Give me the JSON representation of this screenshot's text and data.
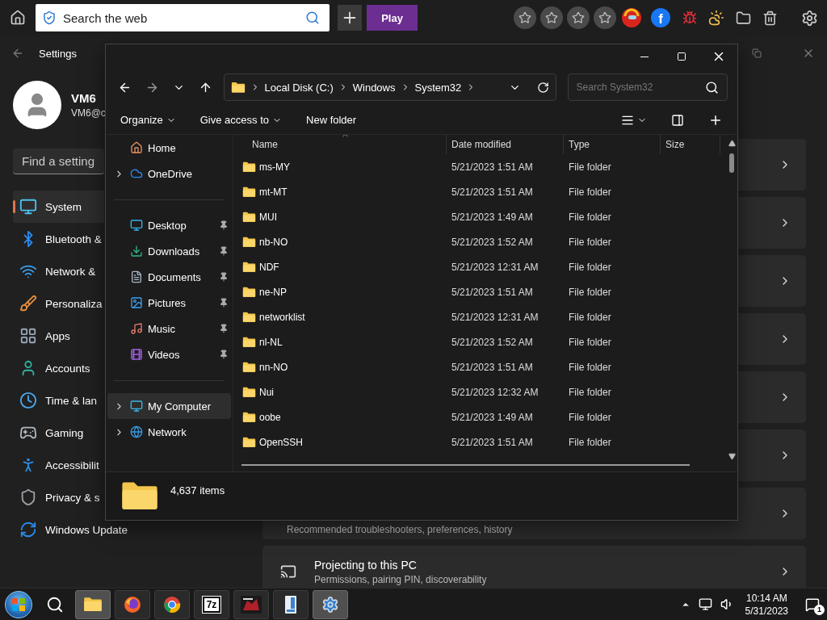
{
  "browser_toolbar": {
    "search": {
      "placeholder": "Search the web"
    },
    "play_button": "Play",
    "shortcuts": [
      {
        "kind": "star"
      },
      {
        "kind": "star"
      },
      {
        "kind": "star"
      },
      {
        "kind": "star"
      },
      {
        "kind": "avatar"
      },
      {
        "kind": "social",
        "label": "f"
      },
      {
        "kind": "bug"
      },
      {
        "kind": "weather"
      },
      {
        "kind": "folder"
      },
      {
        "kind": "trash"
      }
    ]
  },
  "settings": {
    "title": "Settings",
    "user": {
      "name": "VM6",
      "email": "VM6@c"
    },
    "search": {
      "placeholder": "Find a setting"
    },
    "nav": [
      {
        "kind": "system",
        "label": "System",
        "selected": true
      },
      {
        "kind": "bluetooth",
        "label": "Bluetooth &",
        "selected": false
      },
      {
        "kind": "network",
        "label": "Network &",
        "selected": false
      },
      {
        "kind": "personalization",
        "label": "Personaliza",
        "selected": false
      },
      {
        "kind": "apps",
        "label": "Apps",
        "selected": false
      },
      {
        "kind": "accounts",
        "label": "Accounts",
        "selected": false
      },
      {
        "kind": "time",
        "label": "Time & lan",
        "selected": false
      },
      {
        "kind": "gaming",
        "label": "Gaming",
        "selected": false
      },
      {
        "kind": "accessibility",
        "label": "Accessibilit",
        "selected": false
      },
      {
        "kind": "privacy",
        "label": "Privacy & s",
        "selected": false
      },
      {
        "kind": "update",
        "label": "Windows Update",
        "selected": false
      }
    ],
    "cards": [
      {
        "kind": "blank"
      },
      {
        "kind": "blank"
      },
      {
        "kind": "blank"
      },
      {
        "kind": "blank"
      },
      {
        "kind": "blank"
      },
      {
        "kind": "blank"
      },
      {
        "kind": "subtitle",
        "subtitle": "Recommended troubleshooters, preferences, history"
      },
      {
        "kind": "full",
        "title": "Projecting to this PC",
        "subtitle": "Permissions, pairing PIN, discoverability"
      }
    ]
  },
  "explorer": {
    "address": [
      "Local Disk (C:)",
      "Windows",
      "System32"
    ],
    "search": {
      "placeholder": "Search System32"
    },
    "commands": [
      {
        "label": "Organize",
        "dropdown": true
      },
      {
        "label": "Give access to",
        "dropdown": true
      },
      {
        "label": "New folder",
        "dropdown": false
      }
    ],
    "nav_groups": [
      [
        {
          "kind": "home",
          "label": "Home",
          "expandable": false,
          "pinned": false,
          "selected": false
        },
        {
          "kind": "cloud",
          "label": "OneDrive",
          "expandable": true,
          "pinned": false,
          "selected": false
        }
      ],
      [
        {
          "kind": "desktop",
          "label": "Desktop",
          "expandable": false,
          "pinned": true,
          "selected": false
        },
        {
          "kind": "downloads",
          "label": "Downloads",
          "expandable": false,
          "pinned": true,
          "selected": false
        },
        {
          "kind": "documents",
          "label": "Documents",
          "expandable": false,
          "pinned": true,
          "selected": false
        },
        {
          "kind": "pictures",
          "label": "Pictures",
          "expandable": false,
          "pinned": true,
          "selected": false
        },
        {
          "kind": "music",
          "label": "Music",
          "expandable": false,
          "pinned": true,
          "selected": false
        },
        {
          "kind": "videos",
          "label": "Videos",
          "expandable": false,
          "pinned": true,
          "selected": false
        }
      ],
      [
        {
          "kind": "computer",
          "label": "My Computer",
          "expandable": true,
          "pinned": false,
          "selected": true
        },
        {
          "kind": "network",
          "label": "Network",
          "expandable": true,
          "pinned": false,
          "selected": false
        }
      ]
    ],
    "columns": [
      {
        "label": "Name",
        "sorted": true
      },
      {
        "label": "Date modified",
        "sorted": false
      },
      {
        "label": "Type",
        "sorted": false
      },
      {
        "label": "Size",
        "sorted": false
      }
    ],
    "rows": [
      {
        "name": "ms-MY",
        "date": "5/21/2023 1:51 AM",
        "type": "File folder"
      },
      {
        "name": "mt-MT",
        "date": "5/21/2023 1:51 AM",
        "type": "File folder"
      },
      {
        "name": "MUI",
        "date": "5/21/2023 1:49 AM",
        "type": "File folder"
      },
      {
        "name": "nb-NO",
        "date": "5/21/2023 1:52 AM",
        "type": "File folder"
      },
      {
        "name": "NDF",
        "date": "5/21/2023 12:31 AM",
        "type": "File folder"
      },
      {
        "name": "ne-NP",
        "date": "5/21/2023 1:51 AM",
        "type": "File folder"
      },
      {
        "name": "networklist",
        "date": "5/21/2023 12:31 AM",
        "type": "File folder"
      },
      {
        "name": "nl-NL",
        "date": "5/21/2023 1:52 AM",
        "type": "File folder"
      },
      {
        "name": "nn-NO",
        "date": "5/21/2023 1:51 AM",
        "type": "File folder"
      },
      {
        "name": "Nui",
        "date": "5/21/2023 12:32 AM",
        "type": "File folder"
      },
      {
        "name": "oobe",
        "date": "5/21/2023 1:49 AM",
        "type": "File folder"
      },
      {
        "name": "OpenSSH",
        "date": "5/21/2023 1:51 AM",
        "type": "File folder"
      }
    ],
    "status": "4,637 items"
  },
  "taskbar": {
    "apps": [
      {
        "kind": "explorer",
        "active": true
      },
      {
        "kind": "firefox",
        "active": false
      },
      {
        "kind": "chrome",
        "active": false
      },
      {
        "kind": "archiver",
        "label": "7z",
        "active": false
      },
      {
        "kind": "red-app",
        "active": false
      },
      {
        "kind": "document",
        "active": false
      },
      {
        "kind": "settings",
        "active": true
      }
    ],
    "time": "10:14 AM",
    "date": "5/31/2023",
    "notifications": "1"
  }
}
